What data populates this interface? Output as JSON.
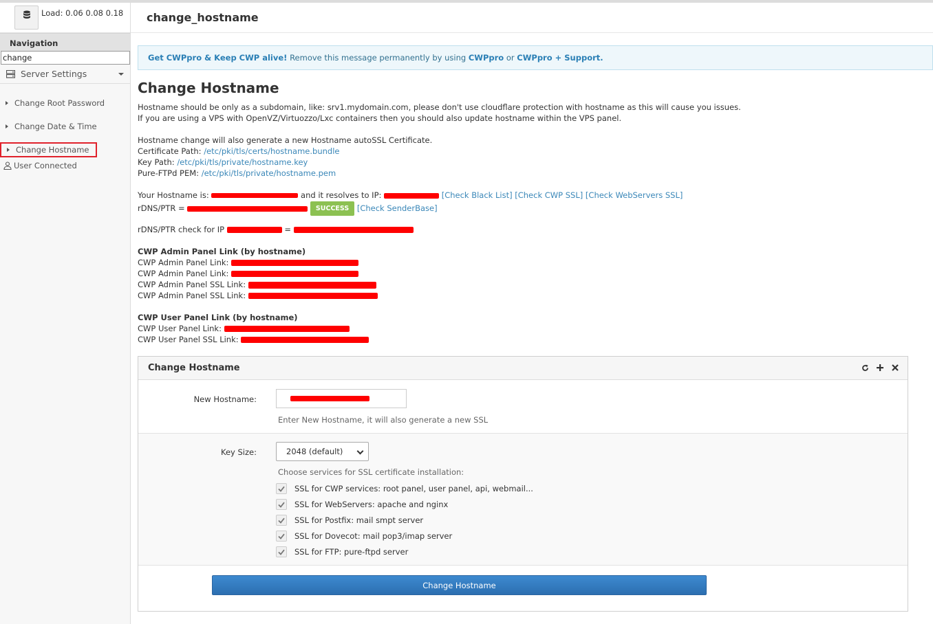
{
  "sidebar": {
    "load_label": "Load: 0.06  0.08  0.18",
    "nav_title": "Navigation",
    "search_value": "change",
    "server_settings": "Server Settings",
    "items": [
      {
        "label": "Change Root Password"
      },
      {
        "label": "Change Date & Time"
      },
      {
        "label": "Change Hostname"
      }
    ],
    "user_connected": "User Connected"
  },
  "header": {
    "title": "change_hostname"
  },
  "promo": {
    "part1": "Get CWPpro & Keep CWP alive!",
    "part2": " Remove this message permanently by using ",
    "part3": "CWPpro",
    "part4": " or ",
    "part5": "CWPpro + Support."
  },
  "main": {
    "heading": "Change Hostname",
    "intro1": "Hostname should be only as a subdomain, like: srv1.mydomain.com, please don't use cloudflare protection with hostname as this will cause you issues.",
    "intro2": "If you are using a VPS with OpenVZ/Virtuozzo/Lxc containers then you should also update hostname within the VPS panel.",
    "cert_intro": "Hostname change will also generate a new Hostname autoSSL Certificate.",
    "cert_path_label": "Certificate Path: ",
    "cert_path": "/etc/pki/tls/certs/hostname.bundle",
    "key_path_label": "Key Path: ",
    "key_path": "/etc/pki/tls/private/hostname.key",
    "pem_label": "Pure-FTPd PEM: ",
    "pem_path": "/etc/pki/tls/private/hostname.pem",
    "hostname_is": "Your Hostname is: ",
    "resolves": " and it resolves to IP: ",
    "check_black": "[Check Black List]",
    "check_cwp_ssl": "[Check CWP SSL]",
    "check_web_ssl": "[Check WebServers SSL]",
    "rdns_label": "rDNS/PTR = ",
    "success": "SUCCESS",
    "check_sender": "[Check SenderBase]",
    "rdns_check": "rDNS/PTR check for IP ",
    "equals": " = ",
    "admin_title": "CWP Admin Panel Link (by hostname)",
    "admin_link": "CWP Admin Panel Link: ",
    "admin_ssl_link": "CWP Admin Panel SSL Link: ",
    "user_title": "CWP User Panel Link (by hostname)",
    "user_link": "CWP User Panel Link: ",
    "user_ssl_link": "CWP User Panel SSL Link: "
  },
  "panel": {
    "title": "Change Hostname",
    "new_hostname_label": "New Hostname:",
    "new_hostname_help": "Enter New Hostname, it will also generate a new SSL",
    "key_size_label": "Key Size:",
    "key_size_value": "2048 (default)",
    "services_label": "Choose services for SSL certificate installation:",
    "services": [
      "SSL for CWP services: root panel, user panel, api, webmail...",
      "SSL for WebServers: apache and nginx",
      "SSL for Postfix: mail smpt server",
      "SSL for Dovecot: mail pop3/imap server",
      "SSL for FTP: pure-ftpd server"
    ],
    "submit": "Change Hostname"
  }
}
